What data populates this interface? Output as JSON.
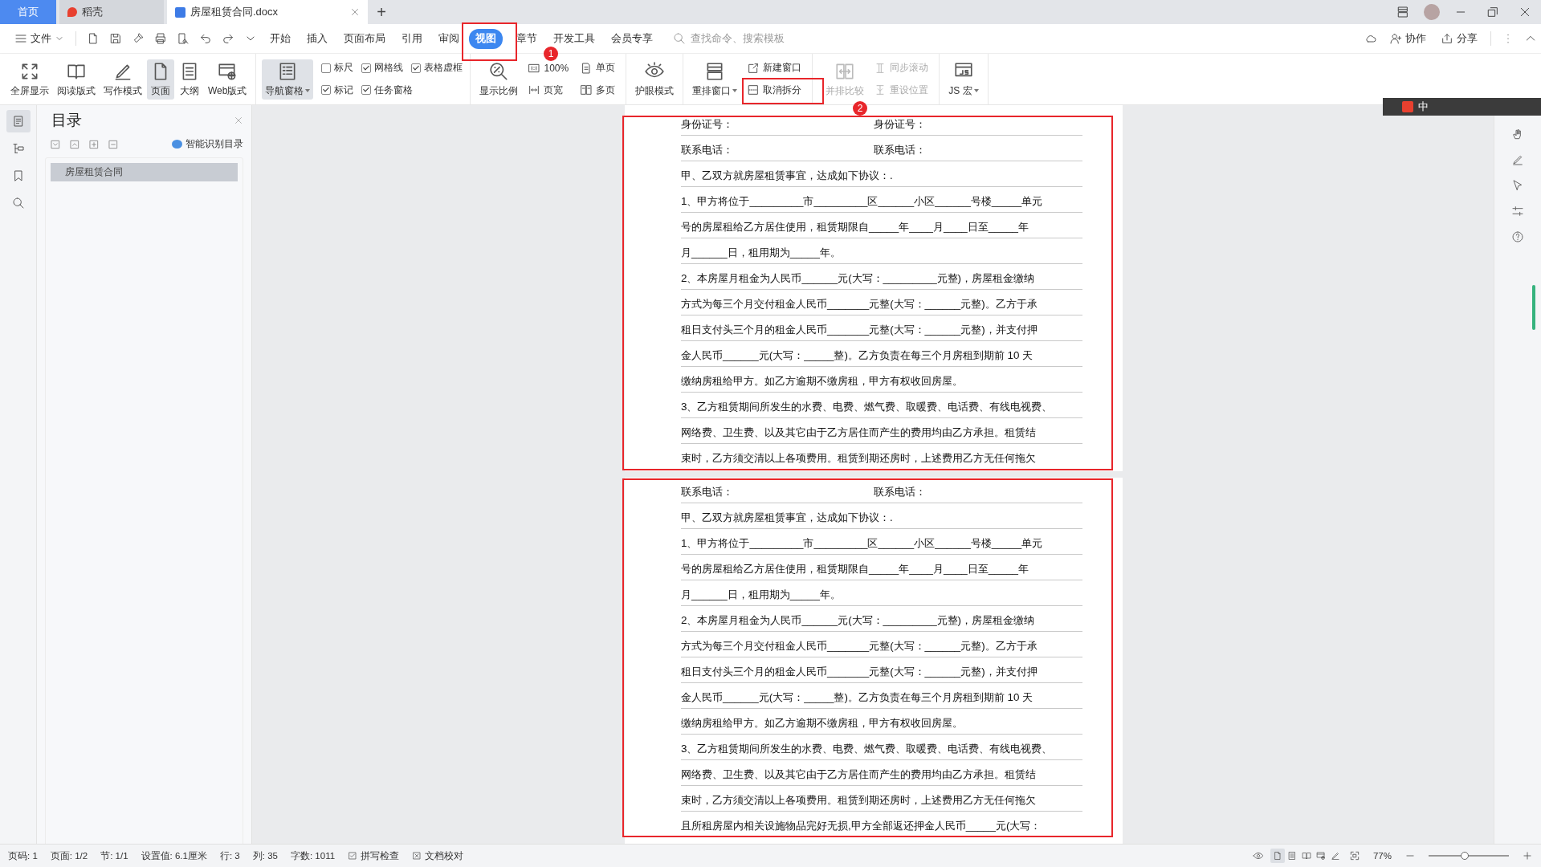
{
  "tabs": [
    {
      "label": "首页",
      "kind": "home",
      "selected": false
    },
    {
      "label": "稻壳",
      "kind": "app",
      "selected": false
    },
    {
      "label": "房屋租赁合同.docx",
      "kind": "doc",
      "selected": true
    }
  ],
  "new_tab": "+",
  "menu": {
    "file": "文件",
    "tabs": [
      {
        "label": "开始",
        "selected": false
      },
      {
        "label": "插入",
        "selected": false
      },
      {
        "label": "页面布局",
        "selected": false
      },
      {
        "label": "引用",
        "selected": false
      },
      {
        "label": "审阅",
        "selected": false
      },
      {
        "label": "视图",
        "selected": true
      },
      {
        "label": "章节",
        "selected": false
      },
      {
        "label": "开发工具",
        "selected": false
      },
      {
        "label": "会员专享",
        "selected": false
      }
    ],
    "search": {
      "placeholder": "查找命令、搜索模板"
    },
    "actions": [
      {
        "label": "协作",
        "kind": "person"
      },
      {
        "label": "分享",
        "kind": "share"
      }
    ]
  },
  "ribbon": [
    {
      "items": [
        {
          "kind": "big",
          "label": "全屏显示",
          "selected": false
        },
        {
          "kind": "big",
          "label": "阅读版式",
          "selected": false
        },
        {
          "kind": "big",
          "label": "写作模式",
          "selected": false
        },
        {
          "kind": "big",
          "label": "页面",
          "selected": true
        },
        {
          "kind": "big",
          "label": "大纲",
          "selected": false
        },
        {
          "kind": "big",
          "label": "Web版式",
          "selected": false
        }
      ]
    },
    {
      "items": [
        {
          "kind": "big",
          "label": "导航窗格",
          "dropdown": true,
          "selected": true
        },
        {
          "kind": "checks",
          "rows": [
            [
              {
                "label": "标尺",
                "checked": false
              },
              {
                "label": "网格线",
                "checked": true
              },
              {
                "label": "表格虚框",
                "checked": true
              }
            ],
            [
              {
                "label": "标记",
                "checked": true
              },
              {
                "label": "任务窗格",
                "checked": true
              }
            ]
          ]
        }
      ]
    },
    {
      "items": [
        {
          "kind": "big",
          "label": "显示比例"
        },
        {
          "kind": "stack",
          "items": [
            {
              "label": "100%"
            },
            {
              "label": "页宽"
            }
          ]
        },
        {
          "kind": "stack",
          "items": [
            {
              "label": "单页"
            },
            {
              "label": "多页"
            }
          ]
        }
      ]
    },
    {
      "items": [
        {
          "kind": "big",
          "label": "护眼模式"
        }
      ]
    },
    {
      "items": [
        {
          "kind": "big",
          "label": "重排窗口",
          "dropdown": true
        },
        {
          "kind": "stack",
          "items": [
            {
              "label": "新建窗口"
            },
            {
              "label": "取消拆分"
            }
          ]
        }
      ]
    },
    {
      "items": [
        {
          "kind": "big",
          "label": "并排比较",
          "disabled": true
        },
        {
          "kind": "stack",
          "items": [
            {
              "label": "同步滚动",
              "disabled": true
            },
            {
              "label": "重设位置",
              "disabled": true
            }
          ]
        }
      ]
    },
    {
      "items": [
        {
          "kind": "big",
          "label": "JS 宏",
          "dropdown": true
        }
      ]
    }
  ],
  "left_tools": [
    {
      "kind": "toc",
      "selected": true
    },
    {
      "kind": "tree",
      "selected": false
    },
    {
      "kind": "bookmark",
      "selected": false
    },
    {
      "kind": "search",
      "selected": false
    }
  ],
  "nav_pane": {
    "title": "目录",
    "smart_label": "智能识别目录",
    "items": [
      {
        "label": "房屋租赁合同",
        "selected": true
      }
    ]
  },
  "panes": [
    {
      "lines": [
        {
          "kind": "pair",
          "left": "身份证号：",
          "right": "身份证号："
        },
        {
          "kind": "pair",
          "left": "联系电话：",
          "right": "联系电话："
        },
        {
          "kind": "text",
          "text": "甲、乙双方就房屋租赁事宜，达成如下协议：."
        },
        {
          "kind": "text",
          "text": "1、甲方将位于_________市_________区______小区______号楼_____单元"
        },
        {
          "kind": "text",
          "text": "号的房屋租给乙方居住使用，租赁期限自_____年____月____日至_____年"
        },
        {
          "kind": "text",
          "text": "月______日，租用期为_____年。"
        },
        {
          "kind": "text",
          "text": "2、本房屋月租金为人民币______元(大写：_________元整)，房屋租金缴纳"
        },
        {
          "kind": "text",
          "text": "方式为每三个月交付租金人民币_______元整(大写：______元整)。乙方于承"
        },
        {
          "kind": "text",
          "text": "租日支付头三个月的租金人民币_______元整(大写：______元整)，并支付押"
        },
        {
          "kind": "text",
          "text": "金人民币______元(大写：_____整)。乙方负责在每三个月房租到期前 10 天"
        },
        {
          "kind": "text",
          "text": "缴纳房租给甲方。如乙方逾期不缴房租，甲方有权收回房屋。"
        },
        {
          "kind": "text",
          "text": "3、乙方租赁期间所发生的水费、电费、燃气费、取暖费、电话费、有线电视费、"
        },
        {
          "kind": "text",
          "text": "网络费、卫生费、以及其它由于乙方居住而产生的费用均由乙方承担。租赁结"
        },
        {
          "kind": "text",
          "text": "束时，乙方须交清以上各项费用。租赁到期还房时，上述费用乙方无任何拖欠"
        }
      ]
    },
    {
      "lines": [
        {
          "kind": "pair",
          "left": "联系电话：",
          "right": "联系电话："
        },
        {
          "kind": "text",
          "text": "甲、乙双方就房屋租赁事宜，达成如下协议：."
        },
        {
          "kind": "text",
          "text": "1、甲方将位于_________市_________区______小区______号楼_____单元"
        },
        {
          "kind": "text",
          "text": "号的房屋租给乙方居住使用，租赁期限自_____年____月____日至_____年"
        },
        {
          "kind": "text",
          "text": "月______日，租用期为_____年。"
        },
        {
          "kind": "text",
          "text": "2、本房屋月租金为人民币______元(大写：_________元整)，房屋租金缴纳"
        },
        {
          "kind": "text",
          "text": "方式为每三个月交付租金人民币_______元整(大写：______元整)。乙方于承"
        },
        {
          "kind": "text",
          "text": "租日支付头三个月的租金人民币_______元整(大写：______元整)，并支付押"
        },
        {
          "kind": "text",
          "text": "金人民币______元(大写：_____整)。乙方负责在每三个月房租到期前 10 天"
        },
        {
          "kind": "text",
          "text": "缴纳房租给甲方。如乙方逾期不缴房租，甲方有权收回房屋。"
        },
        {
          "kind": "text",
          "text": "3、乙方租赁期间所发生的水费、电费、燃气费、取暖费、电话费、有线电视费、"
        },
        {
          "kind": "text",
          "text": "网络费、卫生费、以及其它由于乙方居住而产生的费用均由乙方承担。租赁结"
        },
        {
          "kind": "text",
          "text": "束时，乙方须交清以上各项费用。租赁到期还房时，上述费用乙方无任何拖欠"
        },
        {
          "kind": "text",
          "text": "且所租房屋内相关设施物品完好无损,甲方全部返还押金人民币_____元(大写："
        }
      ]
    }
  ],
  "ime": {
    "label": "中"
  },
  "callouts": [
    "1",
    "2"
  ],
  "status_bar": {
    "items": [
      "页码: 1",
      "页面: 1/2",
      "节: 1/1",
      "设置值: 6.1厘米",
      "行: 3",
      "列: 35",
      "字数: 1011"
    ],
    "tools": [
      {
        "label": "拼写检查",
        "kind": "tick"
      },
      {
        "label": "文档校对",
        "kind": "cross"
      }
    ],
    "views": [
      {
        "kind": "page",
        "selected": true
      },
      {
        "kind": "outline",
        "selected": false
      },
      {
        "kind": "book",
        "selected": false
      },
      {
        "kind": "web",
        "selected": false
      },
      {
        "kind": "pen",
        "selected": false
      }
    ],
    "zoom": "77%",
    "zoom_slider": {
      "level": 0.45
    }
  }
}
